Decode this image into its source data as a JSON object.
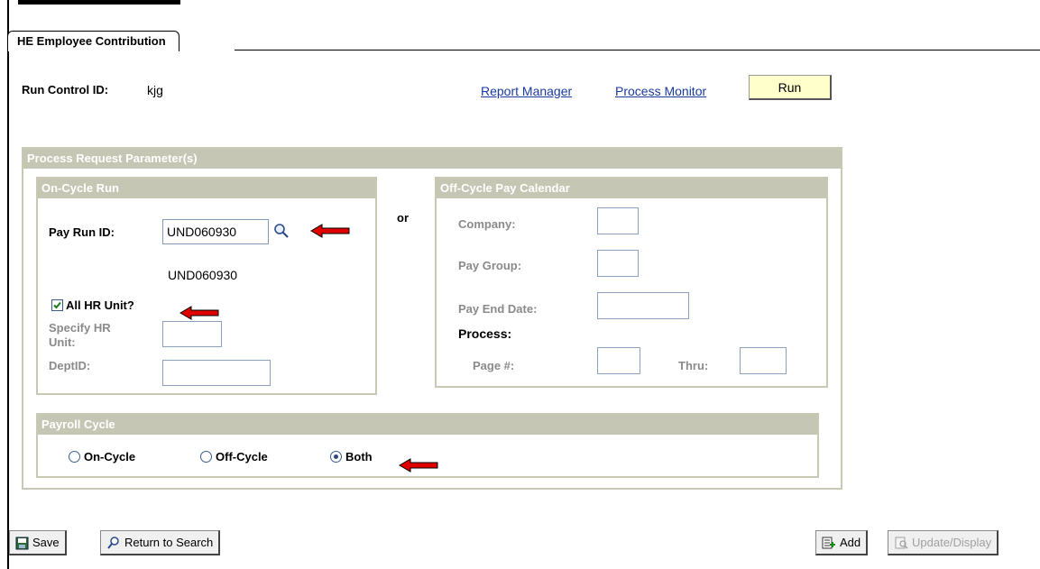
{
  "page": {
    "tab_label": "HE Employee Contribution",
    "run_control_label": "Run Control ID:",
    "run_control_value": "kjg",
    "report_manager_link": "Report Manager",
    "process_monitor_link": "Process Monitor",
    "run_button": "Run"
  },
  "params": {
    "header": "Process Request Parameter(s)",
    "or_label": "or",
    "on_cycle": {
      "header": "On-Cycle Run",
      "pay_run_id_label": "Pay Run ID:",
      "pay_run_id_value": "UND060930",
      "pay_run_id_desc": "UND060930",
      "all_hr_unit_label": "All HR Unit?",
      "all_hr_unit_checked": true,
      "specify_hr_unit_label": "Specify HR Unit:",
      "deptid_label": "DeptID:"
    },
    "off_cycle": {
      "header": "Off-Cycle Pay Calendar",
      "company_label": "Company:",
      "pay_group_label": "Pay Group:",
      "pay_end_date_label": "Pay End Date:",
      "process_label": "Process:",
      "page_label": "Page #:",
      "thru_label": "Thru:"
    },
    "payroll_cycle": {
      "header": "Payroll Cycle",
      "options": [
        "On-Cycle",
        "Off-Cycle",
        "Both"
      ],
      "selected": "Both"
    }
  },
  "toolbar": {
    "save_label": "Save",
    "return_label": "Return to Search",
    "add_label": "Add",
    "update_label": "Update/Display"
  },
  "colors": {
    "group_header": "#c5c6b3",
    "link": "#1a3aa0",
    "run_button_bg": "#ffffcc",
    "arrow": "#e00000"
  }
}
